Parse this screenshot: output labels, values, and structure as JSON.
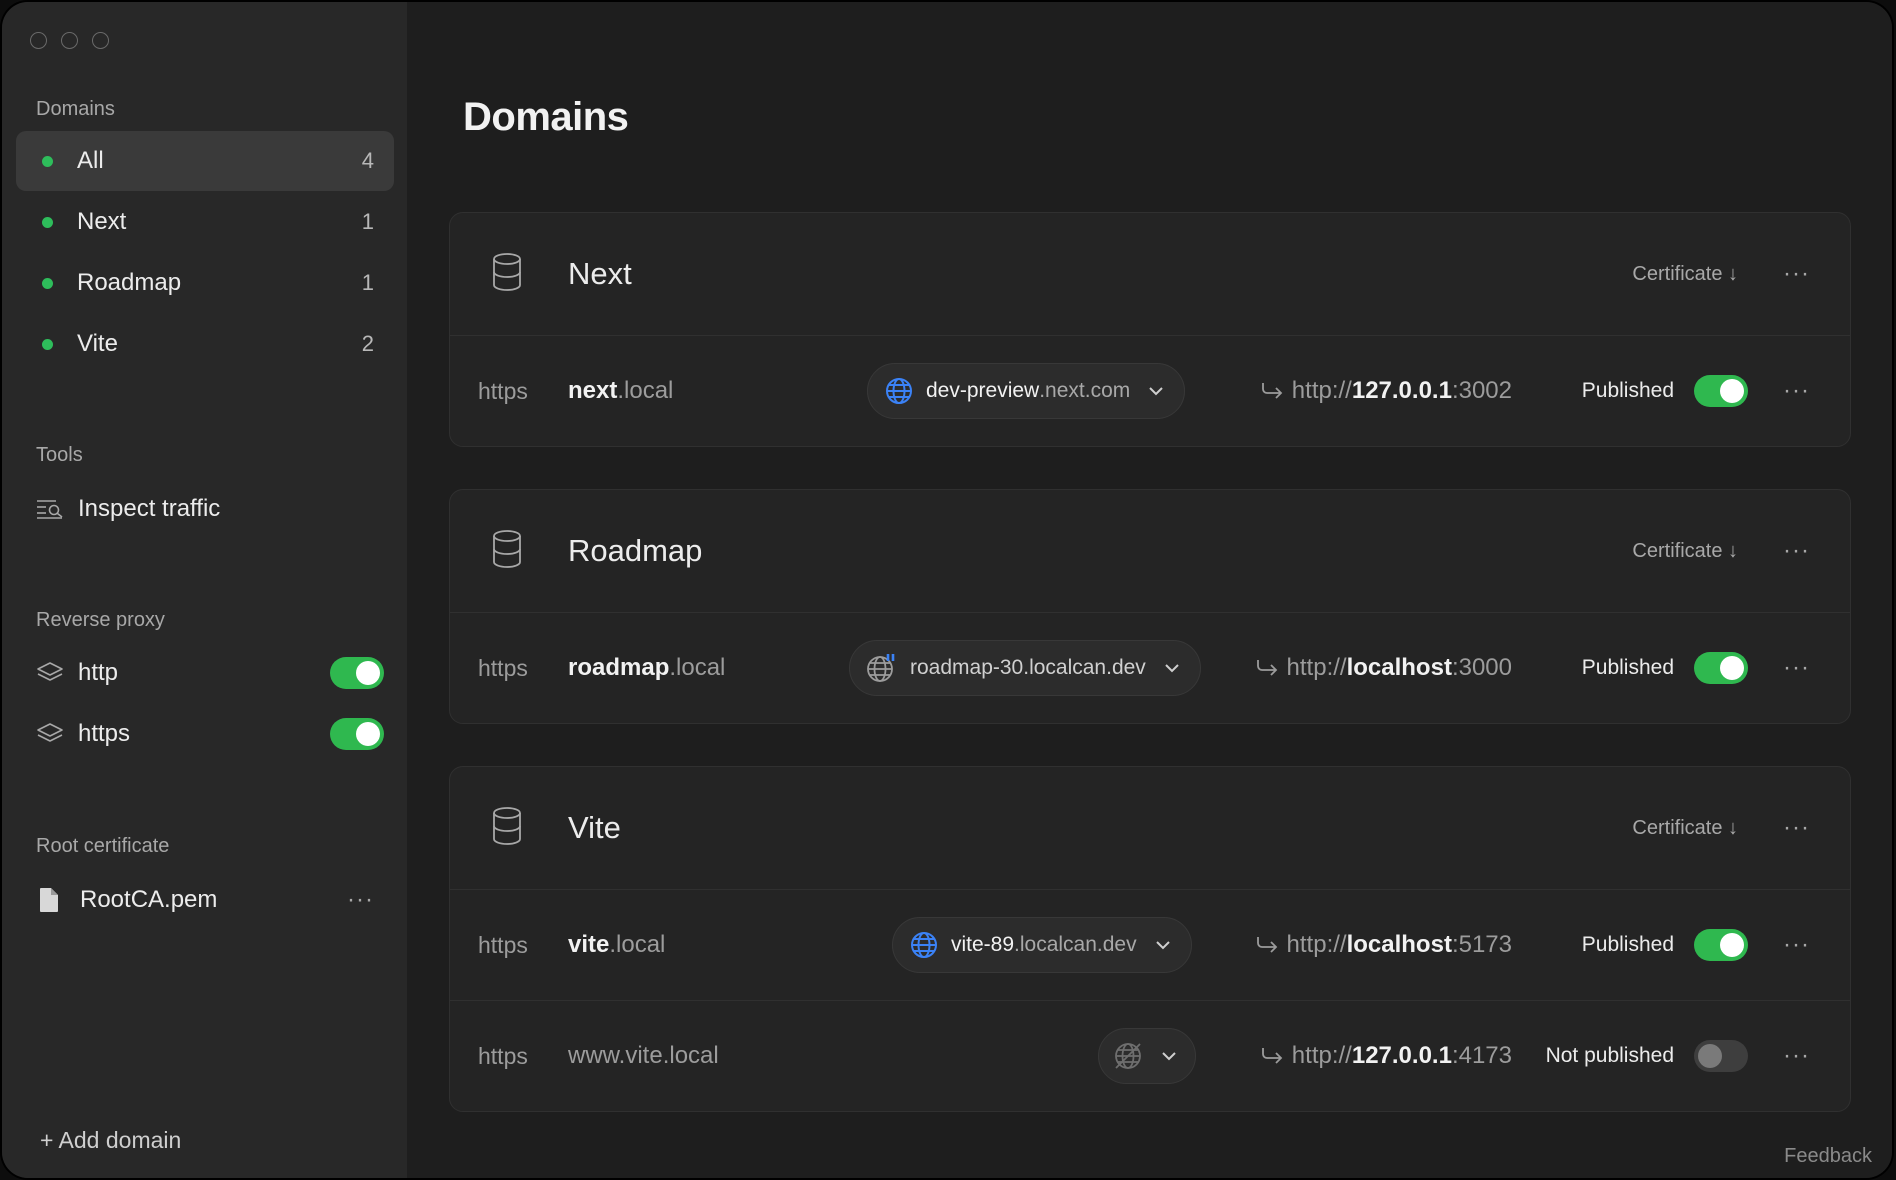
{
  "sidebar": {
    "domains_label": "Domains",
    "domains": [
      {
        "label": "All",
        "count": "4"
      },
      {
        "label": "Next",
        "count": "1"
      },
      {
        "label": "Roadmap",
        "count": "1"
      },
      {
        "label": "Vite",
        "count": "2"
      }
    ],
    "tools_label": "Tools",
    "tools": [
      {
        "label": "Inspect traffic",
        "icon": "inspect-traffic-icon"
      }
    ],
    "proxy_label": "Reverse proxy",
    "proxies": [
      {
        "label": "http",
        "icon": "layers-icon",
        "enabled": true
      },
      {
        "label": "https",
        "icon": "layers-icon",
        "enabled": true
      }
    ],
    "root_cert_label": "Root certificate",
    "root_cert": {
      "label": "RootCA.pem",
      "icon": "file-icon"
    },
    "add_domain": "+ Add domain"
  },
  "main": {
    "title": "Domains",
    "feedback": "Feedback",
    "cards": [
      {
        "name": "Next",
        "certificate_label": "Certificate ↓",
        "rows": [
          {
            "proto": "https",
            "host_bold": "next",
            "host_rest": ".local",
            "public_sub": "dev-preview",
            "public_rest": ".next.com",
            "target_scheme": "http://",
            "target_host": "127.0.0.1",
            "target_port": ":3002",
            "status": "Published",
            "published": true
          }
        ]
      },
      {
        "name": "Roadmap",
        "certificate_label": "Certificate ↓",
        "rows": [
          {
            "proto": "https",
            "host_bold": "roadmap",
            "host_rest": ".local",
            "public_sub": "",
            "public_rest": "roadmap-30.localcan.dev",
            "target_scheme": "http://",
            "target_host": "localhost",
            "target_port": ":3000",
            "status": "Published",
            "published": true
          }
        ]
      },
      {
        "name": "Vite",
        "certificate_label": "Certificate ↓",
        "rows": [
          {
            "proto": "https",
            "host_bold": "vite",
            "host_rest": ".local",
            "public_sub": "vite-89",
            "public_rest": ".localcan.dev",
            "target_scheme": "http://",
            "target_host": "localhost",
            "target_port": ":5173",
            "status": "Published",
            "published": true
          },
          {
            "proto": "https",
            "host_bold": "",
            "host_rest": "www.vite.local",
            "public_sub": "",
            "public_rest": "",
            "target_scheme": "http://",
            "target_host": "127.0.0.1",
            "target_port": ":4173",
            "status": "Not published",
            "published": false
          }
        ]
      }
    ]
  },
  "colors": {
    "accent_green": "#2fb84f",
    "globe_blue": "#3b82f6",
    "background": "#1e1e1e",
    "sidebar": "#282828"
  }
}
